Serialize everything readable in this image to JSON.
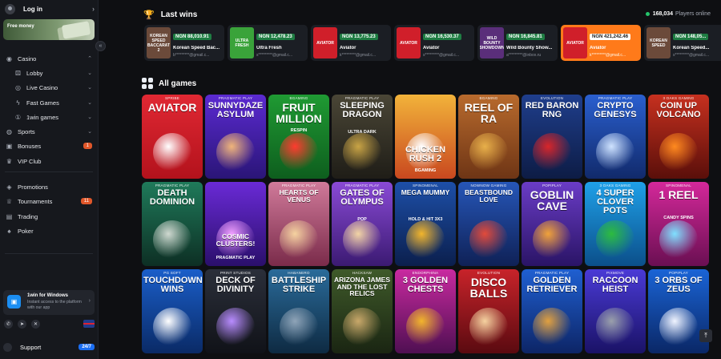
{
  "sidebar": {
    "login": "Log in",
    "promo": "Free money",
    "items": [
      {
        "label": "Casino",
        "icon": "casino-chip-icon",
        "chevron": "⌃"
      },
      {
        "label": "Lobby",
        "icon": "dice-icon",
        "chevron": "⌄"
      },
      {
        "label": "Live Casino",
        "icon": "live-icon",
        "chevron": "⌄"
      },
      {
        "label": "Fast Games",
        "icon": "bolt-icon",
        "chevron": "⌄"
      },
      {
        "label": "1win games",
        "icon": "1win-icon",
        "chevron": "⌄"
      },
      {
        "label": "Sports",
        "icon": "ball-icon",
        "chevron": "⌄"
      },
      {
        "label": "Bonuses",
        "icon": "gift-icon",
        "badge": "1"
      },
      {
        "label": "VIP Club",
        "icon": "crown-icon"
      },
      {
        "label": "Promotions",
        "icon": "megaphone-icon"
      },
      {
        "label": "Tournaments",
        "icon": "trophy-icon",
        "badge": "11"
      },
      {
        "label": "Trading",
        "icon": "chart-icon"
      },
      {
        "label": "Poker",
        "icon": "cards-icon"
      }
    ],
    "windows_app": {
      "title": "1win for Windows",
      "desc": "Instant access to the platform with our app"
    },
    "support": {
      "label": "Support",
      "badge": "24/7"
    }
  },
  "last_wins": {
    "title": "Last wins",
    "players_online_count": "168,034",
    "players_online_label": "Players online",
    "items": [
      {
        "amount": "NGN 88,010.91",
        "game": "Korean Speed Bac...",
        "user": "b*********@gmail.c...",
        "thumb": "KOREAN SPEED BACCARAT 2",
        "bg": "#6b4a3a"
      },
      {
        "amount": "NGN 12,478.23",
        "game": "Ultra Fresh",
        "user": "s*********@gmail.c...",
        "thumb": "ULTRA FRESH",
        "bg": "#3aa33a"
      },
      {
        "amount": "NGN 13,775.23",
        "game": "Aviator",
        "user": "k*********@gmail.c...",
        "thumb": "AVIATOR",
        "bg": "#d01f2a"
      },
      {
        "amount": "NGN 16,530.37",
        "game": "Aviator",
        "user": "s*********@gmail.c...",
        "thumb": "AVIATOR",
        "bg": "#d01f2a"
      },
      {
        "amount": "NGN 16,845.81",
        "game": "Wild Bounty Show...",
        "user": "a*********@inbox.ru",
        "thumb": "WILD BOUNTY SHOWDOWN",
        "bg": "#5a2e7a"
      },
      {
        "amount": "NGN 421,242.46",
        "game": "Aviator",
        "user": "k*********@gmail.c...",
        "thumb": "AVIATOR",
        "bg": "#d01f2a",
        "highlight": true
      },
      {
        "amount": "NGN 148,05...",
        "game": "Korean Speed...",
        "user": "s*********@gmail.c...",
        "thumb": "KOREAN SPEED",
        "bg": "#6b4a3a"
      }
    ]
  },
  "all_games": {
    "title": "All games",
    "tiles": [
      {
        "provider": "SPRIBE",
        "name": "AVIATOR",
        "bg": "linear-gradient(180deg,#e02833,#b3121c)",
        "size": "l",
        "art": "#ffffff"
      },
      {
        "provider": "PRAGMATIC PLAY",
        "name": "SUNNYDAZE ASYLUM",
        "bg": "linear-gradient(180deg,#5b2ad1,#2a1577)",
        "size": "m",
        "art": "#f0b57a"
      },
      {
        "provider": "BGAMING",
        "name": "FRUIT MILLION",
        "sub": "RESPIN",
        "bg": "linear-gradient(180deg,#1f9a33,#0e5e1e)",
        "size": "l",
        "art": "#ff3b2f"
      },
      {
        "provider": "PRAGMATIC PLAY",
        "name": "SLEEPING DRAGON",
        "sub": "ULTRA DARK",
        "bg": "linear-gradient(180deg,#4a4636,#1f1d17)",
        "size": "m",
        "art": "#c9a445"
      },
      {
        "provider": "",
        "name": "CHICKEN RUSH 2",
        "sub": "BGAMING",
        "bg": "linear-gradient(180deg,#f2b33a,#c9481f)",
        "size": "m",
        "art": "#ffffff"
      },
      {
        "provider": "BGAMING",
        "name": "REEL OF RA",
        "bg": "linear-gradient(180deg,#b86a2d,#6e3515)",
        "size": "l",
        "art": "#e8b04a"
      },
      {
        "provider": "EVOLUTION",
        "name": "RED BARON RNG",
        "bg": "linear-gradient(180deg,#1f3e8c,#0d1c45)",
        "size": "m",
        "art": "#d8262a"
      },
      {
        "provider": "PRAGMATIC PLAY",
        "name": "CRYPTO GENESYS",
        "bg": "linear-gradient(180deg,#2a5fcf,#112a6b)",
        "size": "m",
        "art": "#cfe3ff"
      },
      {
        "provider": "3 OAKS GAMING",
        "name": "COIN UP VOLCANO",
        "bg": "linear-gradient(180deg,#c6301f,#5a0f0a)",
        "size": "m",
        "art": "#ff8a1f"
      },
      {
        "provider": "PRAGMATIC PLAY",
        "name": "DEATH DOMINION",
        "bg": "linear-gradient(180deg,#1f7a5a,#0d2f24)",
        "size": "m",
        "art": "#cfd8d0"
      },
      {
        "provider": "",
        "name": "COSMIC CLUSTERS!",
        "sub": "PRAGMATIC PLAY",
        "bg": "linear-gradient(180deg,#6a2ad6,#2a0f6b)",
        "size": "s",
        "art": "#f1a0ff"
      },
      {
        "provider": "PRAGMATIC PLAY",
        "name": "HEARTS OF VENUS",
        "bg": "linear-gradient(180deg,#d07a9a,#7a2b4a)",
        "size": "s",
        "art": "#f5d2a0"
      },
      {
        "provider": "PRAGMATIC PLAY",
        "name": "GATES OF OLYMPUS",
        "sub": "POP",
        "bg": "linear-gradient(180deg,#8a4ad6,#3b1a72)",
        "size": "m",
        "art": "#f2d4a5"
      },
      {
        "provider": "SPINOMENAL",
        "name": "MEGA MUMMY",
        "sub": "HOLD & HIT 3X3",
        "bg": "linear-gradient(180deg,#1d4fa8,#0b1f4d)",
        "size": "s",
        "art": "#f2b52c"
      },
      {
        "provider": "NOWNOW GAMING",
        "name": "BEASTBOUND LOVE",
        "bg": "linear-gradient(180deg,#2656b8,#0f2156)",
        "size": "s",
        "art": "#e24a3a"
      },
      {
        "provider": "POPIPLAY",
        "name": "GOBLIN CAVE",
        "bg": "linear-gradient(180deg,#6a3cc6,#2a1466)",
        "size": "l",
        "art": "#f0a23a"
      },
      {
        "provider": "3 OAKS GAMING",
        "name": "4 SUPER CLOVER POTS",
        "bg": "linear-gradient(180deg,#1fa0e8,#0b4f8a)",
        "size": "m",
        "art": "#2dbb3f"
      },
      {
        "provider": "SPINOMENAL",
        "name": "1 REEL",
        "sub": "CANDY SPINS",
        "bg": "linear-gradient(180deg,#d4289a,#6a0f52)",
        "size": "l",
        "art": "#7fe0ff"
      },
      {
        "provider": "PG SOFT",
        "name": "TOUCHDOWN WINS",
        "bg": "linear-gradient(180deg,#1a5ec9,#0a2a66)",
        "size": "m",
        "art": "#ffffff"
      },
      {
        "provider": "PRINT STUDIOS",
        "name": "DECK OF DIVINITY",
        "bg": "linear-gradient(180deg,#2b2f3a,#101218)",
        "size": "m",
        "art": "#b88cff"
      },
      {
        "provider": "HABANERO",
        "name": "BATTLESHIP STRIKE",
        "bg": "linear-gradient(180deg,#2a6b9a,#0e2a42)",
        "size": "m",
        "art": "#8fa4b8"
      },
      {
        "provider": "HACKSAW",
        "name": "ARIZONA JAMES AND THE LOST RELICS",
        "bg": "linear-gradient(180deg,#3f5a2a,#1a2512)",
        "size": "s",
        "art": "#c9a86a"
      },
      {
        "provider": "ENDORPHINA",
        "name": "3 GOLDEN CHESTS",
        "bg": "linear-gradient(180deg,#c92aa0,#4f0f52)",
        "size": "m",
        "art": "#f2b52c"
      },
      {
        "provider": "EVOLUTION",
        "name": "DISCO BALLS",
        "bg": "linear-gradient(180deg,#c8232a,#5a0a10)",
        "size": "l",
        "art": "#f5d2a0"
      },
      {
        "provider": "PRAGMATIC PLAY",
        "name": "GOLDEN RETRIEVER",
        "bg": "linear-gradient(180deg,#1f5fd1,#0d2566)",
        "size": "m",
        "art": "#e0a040"
      },
      {
        "provider": "PIXMOVE",
        "name": "RACCOON HEIST",
        "bg": "linear-gradient(180deg,#4a3ad6,#1a1266)",
        "size": "m",
        "art": "#9aa0ab"
      },
      {
        "provider": "POPIPLAY",
        "name": "3 ORBS OF ZEUS",
        "bg": "linear-gradient(180deg,#1a64d6,#0a2766)",
        "size": "m",
        "art": "#f0f4ff"
      }
    ]
  },
  "colors": {
    "accent": "#1b6ef2",
    "win_highlight": "#ff7a1a",
    "online_dot": "#25c46b",
    "badge": "#e0572a"
  }
}
